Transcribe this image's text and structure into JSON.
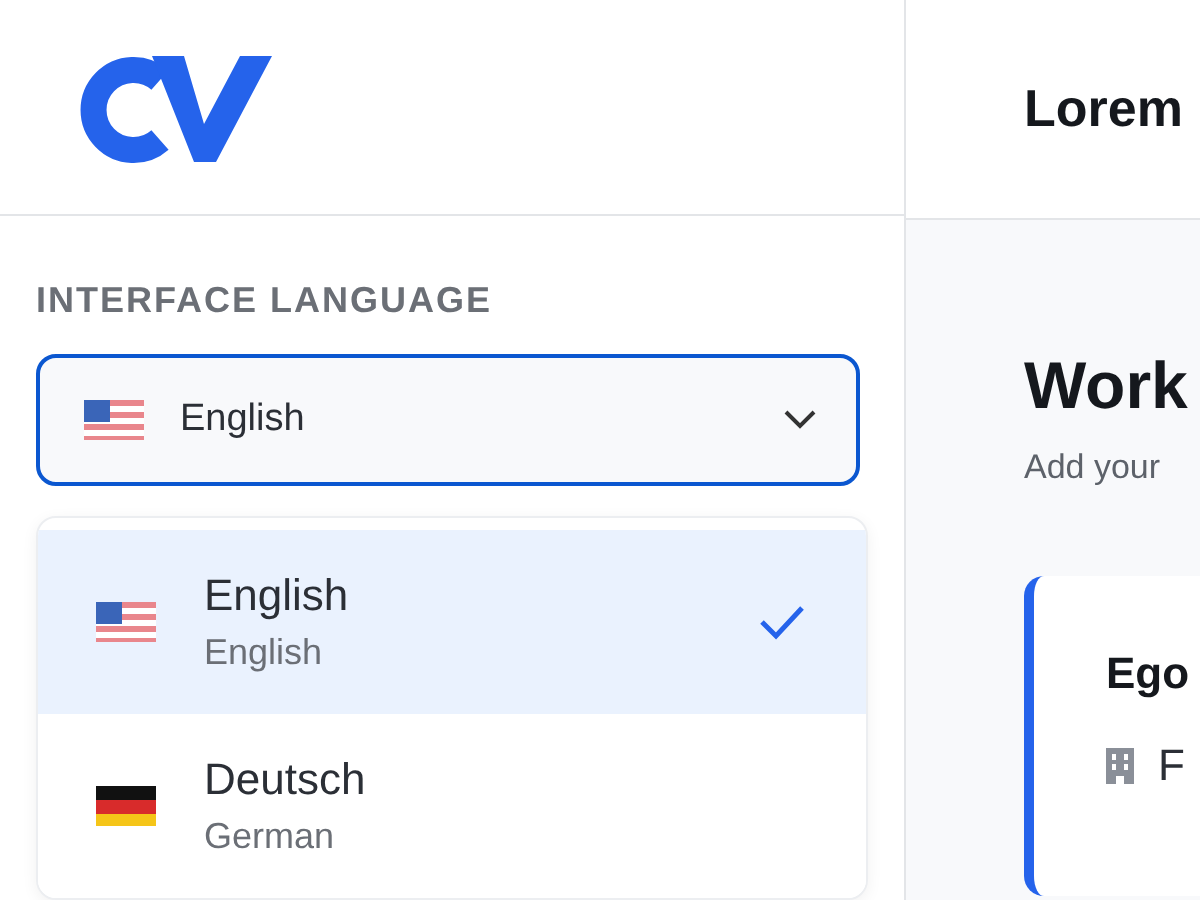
{
  "sidebar": {
    "language_label": "INTERFACE LANGUAGE",
    "select": {
      "kind": "us",
      "value": "English",
      "expanded": true
    },
    "options": [
      {
        "kind": "us",
        "name": "English",
        "native": "English",
        "selected": true
      },
      {
        "kind": "de",
        "name": "Deutsch",
        "native": "German",
        "selected": false
      }
    ]
  },
  "main": {
    "header_title": "Lorem",
    "section_title": "Work",
    "section_subtitle": "Add your",
    "card": {
      "title": "Ego",
      "detail": "F"
    }
  }
}
